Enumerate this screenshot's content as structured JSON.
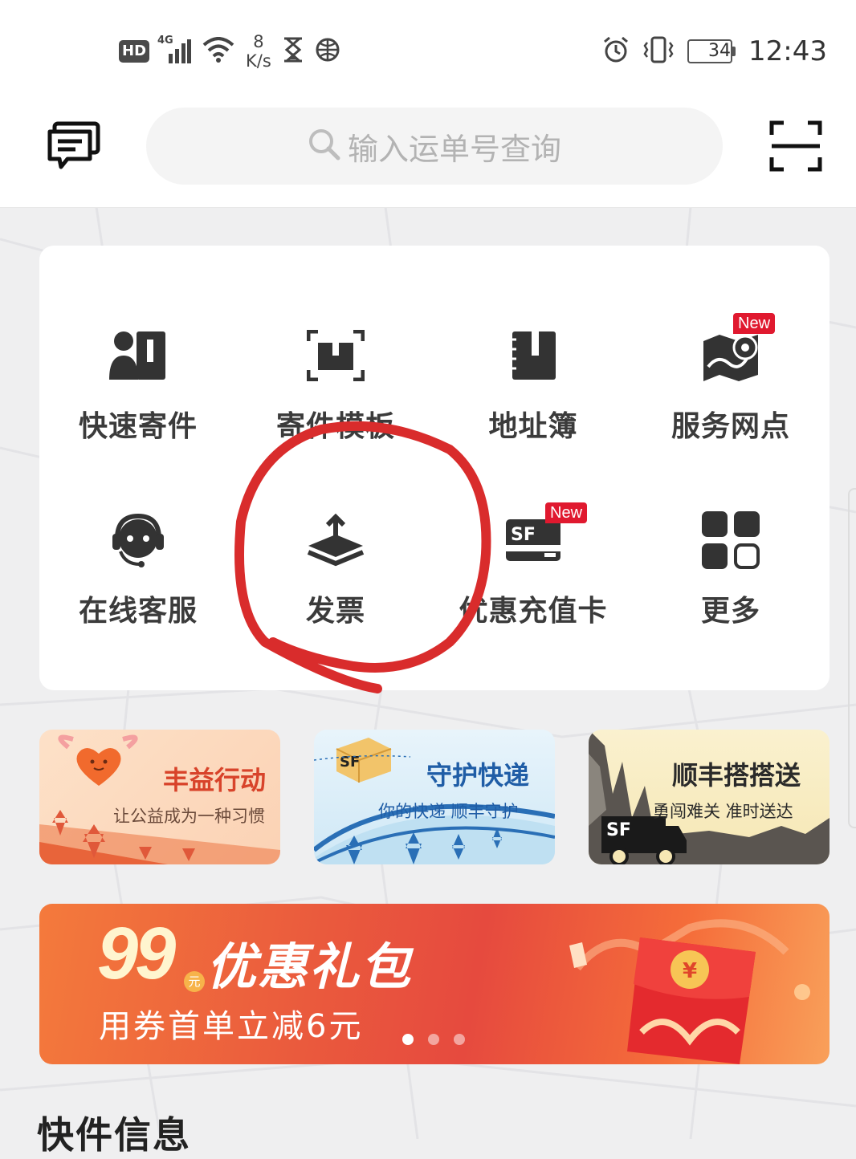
{
  "status_bar": {
    "hd": "HD",
    "network": "4G",
    "speed_value": "8",
    "speed_unit": "K/s",
    "battery": "34",
    "time": "12:43"
  },
  "header": {
    "search_placeholder": "输入运单号查询"
  },
  "services": [
    {
      "label": "快速寄件",
      "icon": "quick-ship-icon"
    },
    {
      "label": "寄件模板",
      "icon": "template-icon"
    },
    {
      "label": "地址簿",
      "icon": "address-book-icon"
    },
    {
      "label": "服务网点",
      "icon": "service-map-icon",
      "badge": "New"
    },
    {
      "label": "在线客服",
      "icon": "customer-service-icon"
    },
    {
      "label": "发票",
      "icon": "invoice-icon"
    },
    {
      "label": "优惠充值卡",
      "icon": "prepaid-card-icon",
      "badge": "New"
    },
    {
      "label": "更多",
      "icon": "more-icon"
    }
  ],
  "promos": [
    {
      "title": "丰益行动",
      "subtitle": "让公益成为一种习惯"
    },
    {
      "title": "守护快递",
      "subtitle": "你的快递 顺丰守护"
    },
    {
      "title": "顺丰搭搭送",
      "subtitle": "勇闯难关 准时送达"
    }
  ],
  "banner": {
    "number": "99",
    "yuan": "元",
    "title": "优惠礼包",
    "subtitle": "用券首单立减6元",
    "coin": "¥",
    "page_count": 3,
    "active_page": 1
  },
  "logos": {
    "sf": "SF"
  },
  "section_title": "快件信息",
  "colors": {
    "accent": "#e0192f",
    "annotation": "#d92c2c",
    "card": "#ffffff"
  }
}
